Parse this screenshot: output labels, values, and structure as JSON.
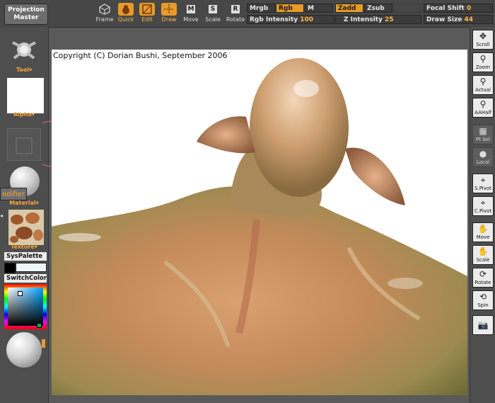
{
  "toolbar": {
    "projection_master": [
      "Projection",
      "Master"
    ],
    "frame": "Frame",
    "quick": "Quick",
    "edit": "Edit",
    "draw": "Draw",
    "move": "Move",
    "scale": "Scale",
    "rotate": "Rotate",
    "mrgb": "Mrgb",
    "rgb": "Rgb",
    "m": "M",
    "rgb_intensity_label": "Rgb Intensity",
    "rgb_intensity_value": "100",
    "zadd": "Zadd",
    "zsub": "Zsub",
    "z_intensity_label": "Z Intensity",
    "z_intensity_value": "25",
    "focal_shift_label": "Focal Shift",
    "focal_shift_value": "0",
    "draw_size_label": "Draw Size",
    "draw_size_value": "44",
    "move_key": "M",
    "scale_key": "S",
    "rotate_key": "R"
  },
  "left_panel": {
    "tool_label": "Tool",
    "alpha_label": "Alpha",
    "material_label": "Material",
    "texture_label": "Texture",
    "syspalette": "SysPalette",
    "switchcolor": "SwitchColor",
    "modifier_tab": "odifier"
  },
  "right_panel": {
    "buttons": [
      "Scroll",
      "Zoom",
      "Actual",
      "AAHalf",
      "Pt Sel",
      "Local",
      "S.Pivot",
      "C.Pivot",
      "Move",
      "Scale",
      "Rotate",
      "Spin"
    ]
  },
  "canvas": {
    "copyright": "Copyright (C) Dorian Bushi, September 2006"
  },
  "colors": {
    "accent": "#e79a2a",
    "label_orange": "#ffa53a",
    "toolbar_bg": "#474747",
    "panel_bg": "#4e4e4e",
    "canvas_bg": "#ffffff"
  },
  "icons": [
    "frame-icon",
    "quick-icon",
    "edit-icon",
    "draw-icon",
    "move-icon",
    "scale-icon",
    "rotate-icon",
    "scroll-icon",
    "zoom-icon",
    "actual-icon",
    "aahalf-icon",
    "ptsel-icon",
    "local-icon",
    "spivot-icon",
    "cpivot-icon",
    "spin-icon",
    "camera-icon"
  ]
}
